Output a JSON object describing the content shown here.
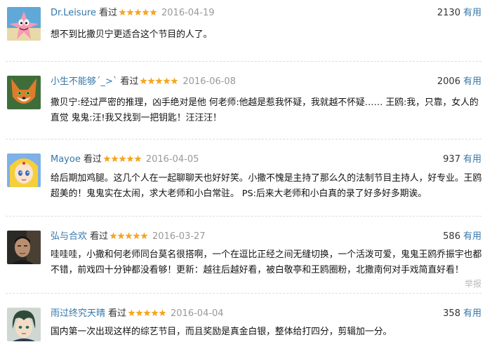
{
  "reviews": [
    {
      "user": "Dr.Leisure",
      "status": "看过",
      "date": "2016-04-19",
      "votes": "2130",
      "useful_label": "有用",
      "content": "想不到比撒贝宁更适合这个节目的人了。",
      "avatar_icon": "cartoon-starfish-avatar-icon",
      "rating_stars": 5
    },
    {
      "user": "小生不能够ˊ_>ˋ",
      "status": "看过",
      "date": "2016-06-08",
      "votes": "2006",
      "useful_label": "有用",
      "content": "撒贝宁:经过严密的推理，凶手绝对是他 何老师:他越是惹我怀疑，我就越不怀疑…… 王鸥:我，只靠，女人的直觉 鬼鬼:汪!我又找到一把钥匙！汪汪汪！",
      "avatar_icon": "cartoon-fox-avatar-icon",
      "rating_stars": 5
    },
    {
      "user": "Mayoe",
      "status": "看过",
      "date": "2016-04-05",
      "votes": "937",
      "useful_label": "有用",
      "content": "给后期加鸡腿。这几个人在一起聊聊天也好好笑。小撒不愧是主持了那么久的法制节目主持人，好专业。王鸥超美的！鬼鬼实在太闹，求大老师和小白常驻。 PS:后来大老师和小白真的录了好多好多期诶。",
      "avatar_icon": "anime-girl-avatar-icon",
      "rating_stars": 5
    },
    {
      "user": "弘与合欢",
      "status": "看过",
      "date": "2016-03-27",
      "votes": "586",
      "useful_label": "有用",
      "content": "哇哇哇，小撒和何老师同台莫名很搭啊，一个在逗比正经之间无缝切换，一个活泼可爱，鬼鬼王鸥乔振宇也都不错，前戏四十分钟都没看够！更新：越往后越好看，被白敬亭和王鸥圈粉，北撒南何对手戏简直好看！",
      "avatar_icon": "man-portrait-avatar-icon",
      "rating_stars": 5,
      "report_label": "举报"
    },
    {
      "user": "雨过终究天晴",
      "status": "看过",
      "date": "2016-04-04",
      "votes": "358",
      "useful_label": "有用",
      "content": "国内第一次出现这样的综艺节目，而且奖励是真金白银，整体给打四分，剪辑加一分。",
      "avatar_icon": "anime-boy-avatar-icon",
      "rating_stars": 5
    }
  ],
  "colors": {
    "link": "#3377aa",
    "star": "#f5a623",
    "muted": "#999999",
    "report": "#bbbbbb"
  }
}
